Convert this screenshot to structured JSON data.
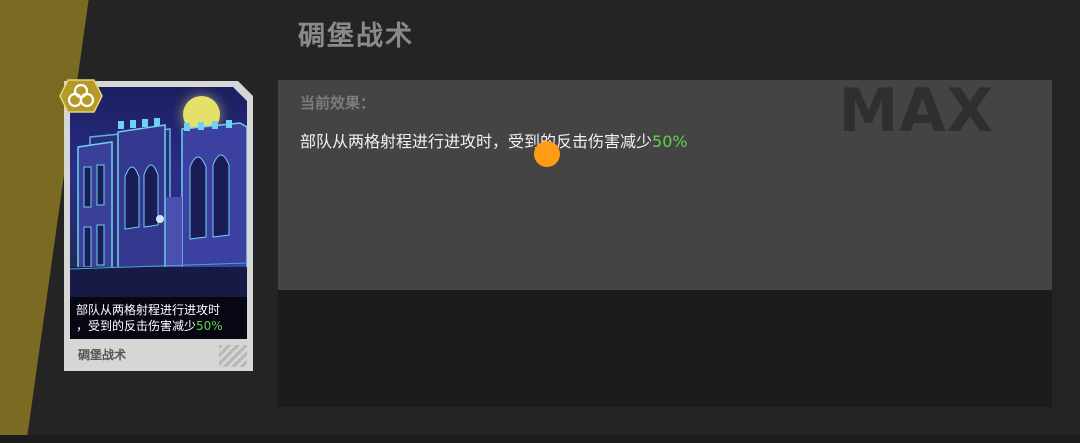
{
  "skill": {
    "title": "碉堡战术",
    "max_label": "MAX",
    "effect_label": "当前效果：",
    "effect_text_pre": "部队从两格射程进行进攻时，受到的反击伤害减少",
    "effect_value": "50%"
  },
  "card": {
    "caption_line1": "部队从两格射程进行进攻时",
    "caption_line2": "，受到的反击伤害减少",
    "caption_value": "50%",
    "name": "碉堡战术",
    "badge_icon": "triple-circle-icon"
  },
  "colors": {
    "accent_olive": "#7a6a22",
    "value_green": "#5fd34a",
    "touch_indicator": "#ff9b14"
  }
}
